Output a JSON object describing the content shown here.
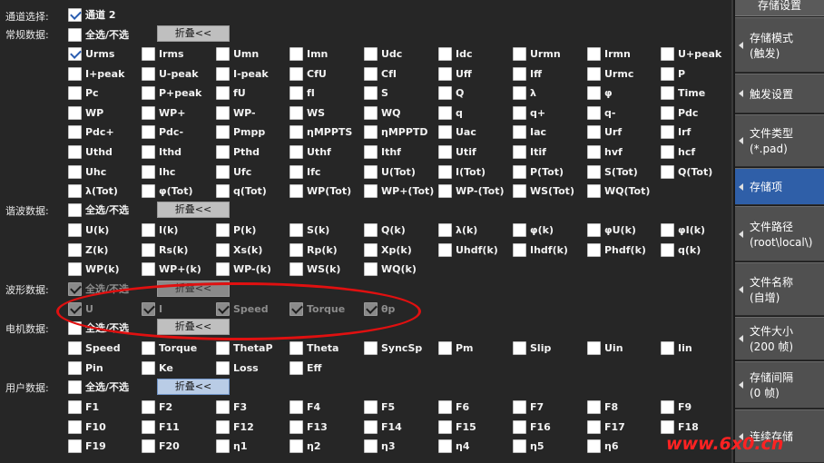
{
  "panel": {
    "channel": {
      "label": "通道选择:",
      "checkbox_label": "通道 2",
      "checked": true
    },
    "sections": [
      {
        "label": "常规数据:",
        "select_all": "全选/不选",
        "fold": "折叠<<",
        "rows": [
          [
            "Urms",
            "Irms",
            "Umn",
            "Imn",
            "Udc",
            "Idc",
            "Urmn",
            "Irmn",
            "U+peak"
          ],
          [
            "I+peak",
            "U-peak",
            "I-peak",
            "CfU",
            "CfI",
            "Uff",
            "Iff",
            "Urmc",
            "P"
          ],
          [
            "Pc",
            "P+peak",
            "fU",
            "fI",
            "S",
            "Q",
            "λ",
            "φ",
            "Time"
          ],
          [
            "WP",
            "WP+",
            "WP-",
            "WS",
            "WQ",
            "q",
            "q+",
            "q-",
            "Pdc"
          ],
          [
            "Pdc+",
            "Pdc-",
            "Pmpp",
            "ηMPPTS",
            "ηMPPTD",
            "Uac",
            "Iac",
            "Urf",
            "Irf"
          ],
          [
            "Uthd",
            "Ithd",
            "Pthd",
            "Uthf",
            "Ithf",
            "Utif",
            "Itif",
            "hvf",
            "hcf"
          ],
          [
            "Uhc",
            "Ihc",
            "Ufc",
            "Ifc",
            "U(Tot)",
            "I(Tot)",
            "P(Tot)",
            "S(Tot)",
            "Q(Tot)"
          ],
          [
            "λ(Tot)",
            "φ(Tot)",
            "q(Tot)",
            "WP(Tot)",
            "WP+(Tot)",
            "WP-(Tot)",
            "WS(Tot)",
            "WQ(Tot)"
          ]
        ]
      },
      {
        "label": "谐波数据:",
        "select_all": "全选/不选",
        "fold": "折叠<<",
        "rows": [
          [
            "U(k)",
            "I(k)",
            "P(k)",
            "S(k)",
            "Q(k)",
            "λ(k)",
            "φ(k)",
            "φU(k)",
            "φI(k)"
          ],
          [
            "Z(k)",
            "Rs(k)",
            "Xs(k)",
            "Rp(k)",
            "Xp(k)",
            "Uhdf(k)",
            "Ihdf(k)",
            "Phdf(k)",
            "q(k)"
          ],
          [
            "WP(k)",
            "WP+(k)",
            "WP-(k)",
            "WS(k)",
            "WQ(k)"
          ]
        ]
      },
      {
        "label": "波形数据:",
        "select_all": "全选/不选",
        "fold": "折叠<<",
        "rows": [
          [
            "U",
            "I",
            "Speed",
            "Torque",
            "θp"
          ]
        ]
      },
      {
        "label": "电机数据:",
        "select_all": "全选/不选",
        "fold": "折叠<<",
        "rows": [
          [
            "Speed",
            "Torque",
            "ThetaP",
            "Theta",
            "SyncSp",
            "Pm",
            "Slip",
            "Uin",
            "Iin"
          ],
          [
            "Pin",
            "Ke",
            "Loss",
            "Eff"
          ]
        ]
      },
      {
        "label": "用户数据:",
        "select_all": "全选/不选",
        "fold": "折叠<<",
        "rows": [
          [
            "F1",
            "F2",
            "F3",
            "F4",
            "F5",
            "F6",
            "F7",
            "F8",
            "F9"
          ],
          [
            "F10",
            "F11",
            "F12",
            "F13",
            "F14",
            "F15",
            "F16",
            "F17",
            "F18"
          ],
          [
            "F19",
            "F20",
            "η1",
            "η2",
            "η3",
            "η4",
            "η5",
            "η6"
          ]
        ]
      }
    ]
  },
  "sidebar": {
    "title": "存储设置",
    "items": [
      {
        "line1": "存储模式",
        "line2": "(触发)"
      },
      {
        "line1": "触发设置",
        "line2": ""
      },
      {
        "line1": "文件类型",
        "line2": "(*.pad)"
      },
      {
        "line1": "存储项",
        "line2": ""
      },
      {
        "line1": "文件路径",
        "line2": "(root\\local\\)"
      },
      {
        "line1": "文件名称",
        "line2": "(自增)"
      },
      {
        "line1": "文件大小",
        "line2": "(200 帧)"
      },
      {
        "line1": "存储间隔",
        "line2": "(0 帧)"
      },
      {
        "line1": "连续存储",
        "line2": ""
      }
    ]
  },
  "watermark": "www.6x0.cn",
  "colors": {
    "accent": "#2f5fa8",
    "annotation": "#e01010"
  }
}
